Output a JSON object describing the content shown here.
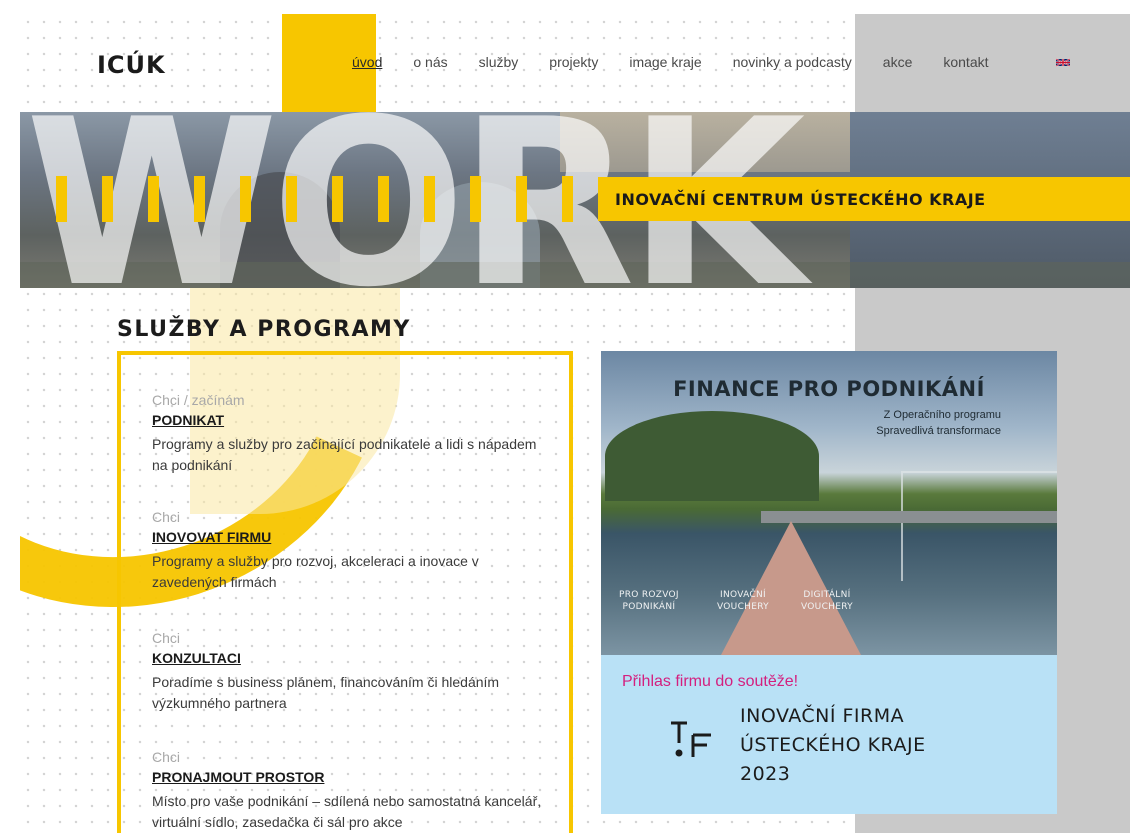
{
  "header": {
    "logo": "ICÚK",
    "nav": [
      "úvod",
      "o nás",
      "služby",
      "projekty",
      "image kraje",
      "novinky a podcasty",
      "akce",
      "kontakt"
    ],
    "active_nav": "úvod",
    "language_icon": "uk-flag-icon"
  },
  "hero": {
    "background_letters": "WORK",
    "banner": "INOVAČNÍ CENTRUM ÚSTECKÉHO KRAJE"
  },
  "services": {
    "title": "SLUŽBY A PROGRAMY",
    "items": [
      {
        "pre": "Chci / začínám",
        "head": "PODNIKAT",
        "desc": "Programy a služby pro začínající podnikatele a lidi s nápadem na podnikání"
      },
      {
        "pre": "Chci",
        "head": "INOVOVAT FIRMU",
        "desc": "Programy a služby pro rozvoj, akceleraci a inovace v zavedených firmách"
      },
      {
        "pre": "Chci",
        "head": "KONZULTACI",
        "desc": "Poradíme s business plánem, financováním či hledáním výzkumného partnera"
      },
      {
        "pre": "Chci",
        "head": "PRONAJMOUT PROSTOR",
        "desc": "Místo pro vaše podnikání – sdílená nebo samostatná kancelář, virtuální sídlo, zasedačka či sál pro akce"
      }
    ]
  },
  "promo": {
    "title": "FINANCE PRO PODNIKÁNÍ",
    "subtitle_line1": "Z Operačního programu",
    "subtitle_line2": "Spravedlivá transformace",
    "labels": [
      {
        "line1": "PRO ROZVOJ",
        "line2": "PODNIKÁNÍ"
      },
      {
        "line1": "INOVAČNÍ",
        "line2": "VOUCHERY"
      },
      {
        "line1": "DIGITÁLNÍ",
        "line2": "VOUCHERY"
      }
    ],
    "cta": "Přihlas firmu do soutěže!",
    "competition_line1": "INOVAČNÍ FIRMA",
    "competition_line2": "ÚSTECKÉHO KRAJE",
    "competition_line3": "2023"
  },
  "colors": {
    "accent_yellow": "#f7c600",
    "promo_blue": "#b9e1f6",
    "cta_pink": "#d4207f",
    "side_grey": "#c9c9c9"
  }
}
